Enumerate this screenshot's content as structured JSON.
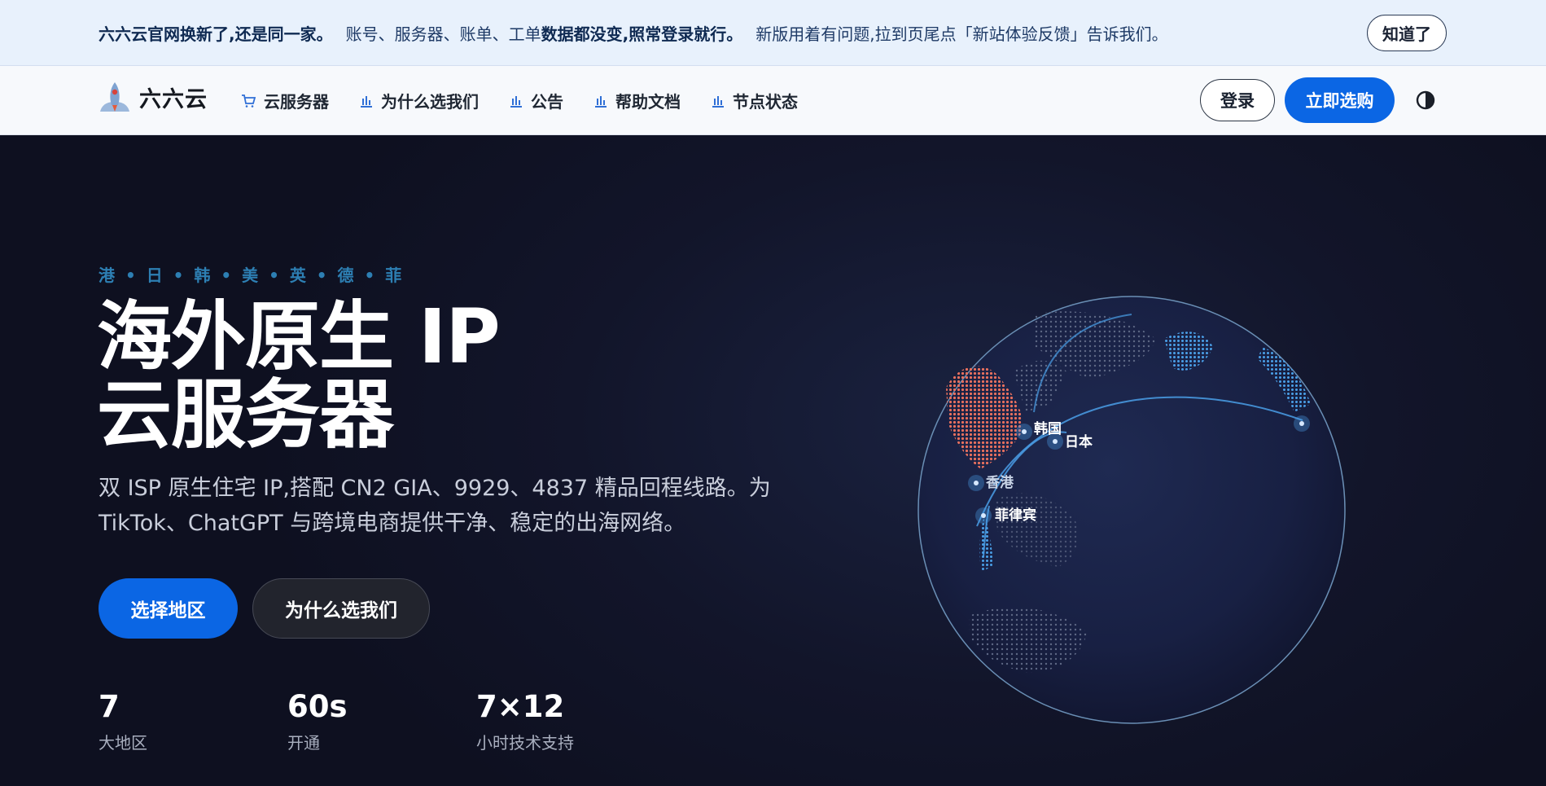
{
  "notice": {
    "part1": "六六云官网换新了,还是同一家。",
    "part2": "账号、服务器、账单、工单",
    "part3": "数据都没变,照常登录就行。",
    "part4": "新版用着有问题,拉到页尾点「新站体验反馈」告诉我们。",
    "dismiss_label": "知道了"
  },
  "nav": {
    "brand": "六六云",
    "items": [
      {
        "label": "云服务器",
        "icon": "cart-icon"
      },
      {
        "label": "为什么选我们",
        "icon": "bar-chart-icon"
      },
      {
        "label": "公告",
        "icon": "bar-chart-icon"
      },
      {
        "label": "帮助文档",
        "icon": "bar-chart-icon"
      },
      {
        "label": "节点状态",
        "icon": "bar-chart-icon"
      }
    ],
    "login_label": "登录",
    "buy_label": "立即选购",
    "theme_icon": "contrast-icon"
  },
  "hero": {
    "eyebrow": "港 • 日 • 韩 • 美 • 英 • 德 • 菲",
    "title_line1": "海外原生 IP",
    "title_line2": "云服务器",
    "description": "双 ISP 原生住宅 IP,搭配 CN2 GIA、9929、4837 精品回程线路。为 TikTok、ChatGPT 与跨境电商提供干净、稳定的出海网络。",
    "cta_primary": "选择地区",
    "cta_secondary": "为什么选我们",
    "stats": [
      {
        "value": "7",
        "label": "大地区"
      },
      {
        "value": "60s",
        "label": "开通"
      },
      {
        "value": "7×12",
        "label": "小时技术支持"
      }
    ]
  },
  "globe": {
    "labels": [
      "韩国",
      "日本",
      "香港",
      "菲律宾"
    ],
    "colors": {
      "china": "#e8705e",
      "accent": "#4a9fe8",
      "rim": "#6a8fb5"
    }
  }
}
